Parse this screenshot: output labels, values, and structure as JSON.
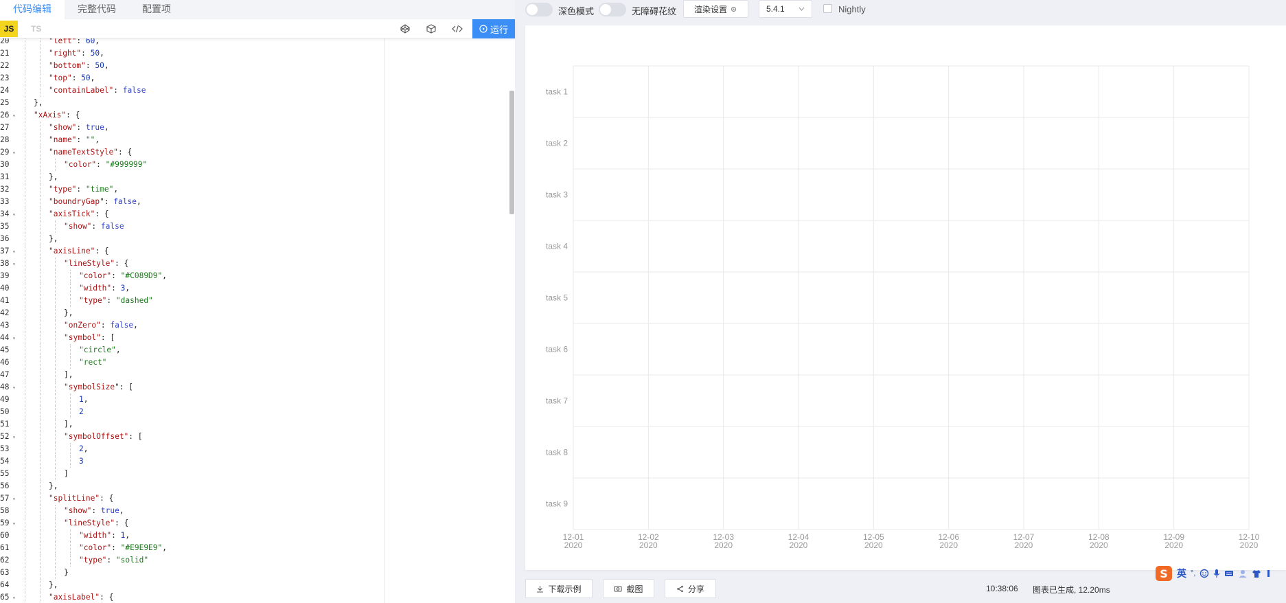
{
  "left_panel": {
    "tabs": [
      {
        "label": "代码编辑",
        "active": true
      },
      {
        "label": "完整代码",
        "active": false
      },
      {
        "label": "配置项",
        "active": false
      }
    ],
    "lang_js": "JS",
    "lang_ts": "TS",
    "icons": [
      "codepen-icon",
      "codesandbox-icon",
      "code-icon"
    ],
    "run_label": "运行"
  },
  "code": {
    "first_line": 20,
    "lines": [
      {
        "indent": 2,
        "text": [
          [
            "k",
            "\"left\""
          ],
          [
            "p",
            ": "
          ],
          [
            "n",
            "60"
          ],
          [
            "p",
            ","
          ]
        ]
      },
      {
        "indent": 2,
        "text": [
          [
            "k",
            "\"right\""
          ],
          [
            "p",
            ": "
          ],
          [
            "n",
            "50"
          ],
          [
            "p",
            ","
          ]
        ]
      },
      {
        "indent": 2,
        "text": [
          [
            "k",
            "\"bottom\""
          ],
          [
            "p",
            ": "
          ],
          [
            "n",
            "50"
          ],
          [
            "p",
            ","
          ]
        ]
      },
      {
        "indent": 2,
        "text": [
          [
            "k",
            "\"top\""
          ],
          [
            "p",
            ": "
          ],
          [
            "n",
            "50"
          ],
          [
            "p",
            ","
          ]
        ]
      },
      {
        "indent": 2,
        "text": [
          [
            "k",
            "\"containLabel\""
          ],
          [
            "p",
            ": "
          ],
          [
            "b",
            "false"
          ]
        ]
      },
      {
        "indent": 1,
        "text": [
          [
            "p",
            "},"
          ]
        ]
      },
      {
        "indent": 1,
        "fold": true,
        "text": [
          [
            "k",
            "\"xAxis\""
          ],
          [
            "p",
            ": {"
          ]
        ]
      },
      {
        "indent": 2,
        "text": [
          [
            "k",
            "\"show\""
          ],
          [
            "p",
            ": "
          ],
          [
            "b",
            "true"
          ],
          [
            "p",
            ","
          ]
        ]
      },
      {
        "indent": 2,
        "text": [
          [
            "k",
            "\"name\""
          ],
          [
            "p",
            ": "
          ],
          [
            "s",
            "\"\""
          ],
          [
            "p",
            ","
          ]
        ]
      },
      {
        "indent": 2,
        "fold": true,
        "text": [
          [
            "k",
            "\"nameTextStyle\""
          ],
          [
            "p",
            ": {"
          ]
        ]
      },
      {
        "indent": 3,
        "text": [
          [
            "k",
            "\"color\""
          ],
          [
            "p",
            ": "
          ],
          [
            "s",
            "\"#999999\""
          ]
        ]
      },
      {
        "indent": 2,
        "text": [
          [
            "p",
            "},"
          ]
        ]
      },
      {
        "indent": 2,
        "text": [
          [
            "k",
            "\"type\""
          ],
          [
            "p",
            ": "
          ],
          [
            "s",
            "\"time\""
          ],
          [
            "p",
            ","
          ]
        ]
      },
      {
        "indent": 2,
        "text": [
          [
            "k",
            "\"boundryGap\""
          ],
          [
            "p",
            ": "
          ],
          [
            "b",
            "false"
          ],
          [
            "p",
            ","
          ]
        ]
      },
      {
        "indent": 2,
        "fold": true,
        "text": [
          [
            "k",
            "\"axisTick\""
          ],
          [
            "p",
            ": {"
          ]
        ]
      },
      {
        "indent": 3,
        "text": [
          [
            "k",
            "\"show\""
          ],
          [
            "p",
            ": "
          ],
          [
            "b",
            "false"
          ]
        ]
      },
      {
        "indent": 2,
        "text": [
          [
            "p",
            "},"
          ]
        ]
      },
      {
        "indent": 2,
        "fold": true,
        "text": [
          [
            "k",
            "\"axisLine\""
          ],
          [
            "p",
            ": {"
          ]
        ]
      },
      {
        "indent": 3,
        "fold": true,
        "text": [
          [
            "k",
            "\"lineStyle\""
          ],
          [
            "p",
            ": {"
          ]
        ]
      },
      {
        "indent": 4,
        "text": [
          [
            "k",
            "\"color\""
          ],
          [
            "p",
            ": "
          ],
          [
            "s",
            "\"#C089D9\""
          ],
          [
            "p",
            ","
          ]
        ]
      },
      {
        "indent": 4,
        "text": [
          [
            "k",
            "\"width\""
          ],
          [
            "p",
            ": "
          ],
          [
            "n",
            "3"
          ],
          [
            "p",
            ","
          ]
        ]
      },
      {
        "indent": 4,
        "text": [
          [
            "k",
            "\"type\""
          ],
          [
            "p",
            ": "
          ],
          [
            "s",
            "\"dashed\""
          ]
        ]
      },
      {
        "indent": 3,
        "text": [
          [
            "p",
            "},"
          ]
        ]
      },
      {
        "indent": 3,
        "text": [
          [
            "k",
            "\"onZero\""
          ],
          [
            "p",
            ": "
          ],
          [
            "b",
            "false"
          ],
          [
            "p",
            ","
          ]
        ]
      },
      {
        "indent": 3,
        "fold": true,
        "text": [
          [
            "k",
            "\"symbol\""
          ],
          [
            "p",
            ": ["
          ]
        ]
      },
      {
        "indent": 4,
        "text": [
          [
            "s",
            "\"circle\""
          ],
          [
            "p",
            ","
          ]
        ]
      },
      {
        "indent": 4,
        "text": [
          [
            "s",
            "\"rect\""
          ]
        ]
      },
      {
        "indent": 3,
        "text": [
          [
            "p",
            "],"
          ]
        ]
      },
      {
        "indent": 3,
        "fold": true,
        "text": [
          [
            "k",
            "\"symbolSize\""
          ],
          [
            "p",
            ": ["
          ]
        ]
      },
      {
        "indent": 4,
        "text": [
          [
            "n",
            "1"
          ],
          [
            "p",
            ","
          ]
        ]
      },
      {
        "indent": 4,
        "text": [
          [
            "n",
            "2"
          ]
        ]
      },
      {
        "indent": 3,
        "text": [
          [
            "p",
            "],"
          ]
        ]
      },
      {
        "indent": 3,
        "fold": true,
        "text": [
          [
            "k",
            "\"symbolOffset\""
          ],
          [
            "p",
            ": ["
          ]
        ]
      },
      {
        "indent": 4,
        "text": [
          [
            "n",
            "2"
          ],
          [
            "p",
            ","
          ]
        ]
      },
      {
        "indent": 4,
        "text": [
          [
            "n",
            "3"
          ]
        ]
      },
      {
        "indent": 3,
        "text": [
          [
            "p",
            "]"
          ]
        ]
      },
      {
        "indent": 2,
        "text": [
          [
            "p",
            "},"
          ]
        ]
      },
      {
        "indent": 2,
        "fold": true,
        "text": [
          [
            "k",
            "\"splitLine\""
          ],
          [
            "p",
            ": {"
          ]
        ]
      },
      {
        "indent": 3,
        "text": [
          [
            "k",
            "\"show\""
          ],
          [
            "p",
            ": "
          ],
          [
            "b",
            "true"
          ],
          [
            "p",
            ","
          ]
        ]
      },
      {
        "indent": 3,
        "fold": true,
        "text": [
          [
            "k",
            "\"lineStyle\""
          ],
          [
            "p",
            ": {"
          ]
        ]
      },
      {
        "indent": 4,
        "text": [
          [
            "k",
            "\"width\""
          ],
          [
            "p",
            ": "
          ],
          [
            "n",
            "1"
          ],
          [
            "p",
            ","
          ]
        ]
      },
      {
        "indent": 4,
        "text": [
          [
            "k",
            "\"color\""
          ],
          [
            "p",
            ": "
          ],
          [
            "s",
            "\"#E9E9E9\""
          ],
          [
            "p",
            ","
          ]
        ]
      },
      {
        "indent": 4,
        "text": [
          [
            "k",
            "\"type\""
          ],
          [
            "p",
            ": "
          ],
          [
            "s",
            "\"solid\""
          ]
        ]
      },
      {
        "indent": 3,
        "text": [
          [
            "p",
            "}"
          ]
        ]
      },
      {
        "indent": 2,
        "text": [
          [
            "p",
            "},"
          ]
        ]
      },
      {
        "indent": 2,
        "fold": true,
        "text": [
          [
            "k",
            "\"axisLabel\""
          ],
          [
            "p",
            ": {"
          ]
        ]
      }
    ]
  },
  "right_panel": {
    "dark_mode_label": "深色模式",
    "barrier_free_label": "无障碍花纹",
    "render_settings_label": "渲染设置",
    "version_value": "5.4.1",
    "nightly_label": "Nightly",
    "download_label": "下载示例",
    "screenshot_label": "截图",
    "share_label": "分享",
    "status_time": "10:38:06",
    "status_message": "图表已生成, 12.20ms",
    "ime_label": "英"
  },
  "chart_data": {
    "type": "gantt",
    "categories": [
      "task 1",
      "task 2",
      "task 3",
      "task 4",
      "task 5",
      "task 6",
      "task 7",
      "task 8",
      "task 9"
    ],
    "x_ticks": [
      {
        "date": "12-01",
        "year": "2020"
      },
      {
        "date": "12-02",
        "year": "2020"
      },
      {
        "date": "12-03",
        "year": "2020"
      },
      {
        "date": "12-04",
        "year": "2020"
      },
      {
        "date": "12-05",
        "year": "2020"
      },
      {
        "date": "12-06",
        "year": "2020"
      },
      {
        "date": "12-07",
        "year": "2020"
      },
      {
        "date": "12-08",
        "year": "2020"
      },
      {
        "date": "12-09",
        "year": "2020"
      },
      {
        "date": "12-10",
        "year": "2020"
      }
    ],
    "x_range": [
      "2020-12-01",
      "2020-12-10"
    ],
    "series": [],
    "grid": true,
    "split_line_color": "#E9E9E9",
    "axis_label_color": "#999999"
  }
}
